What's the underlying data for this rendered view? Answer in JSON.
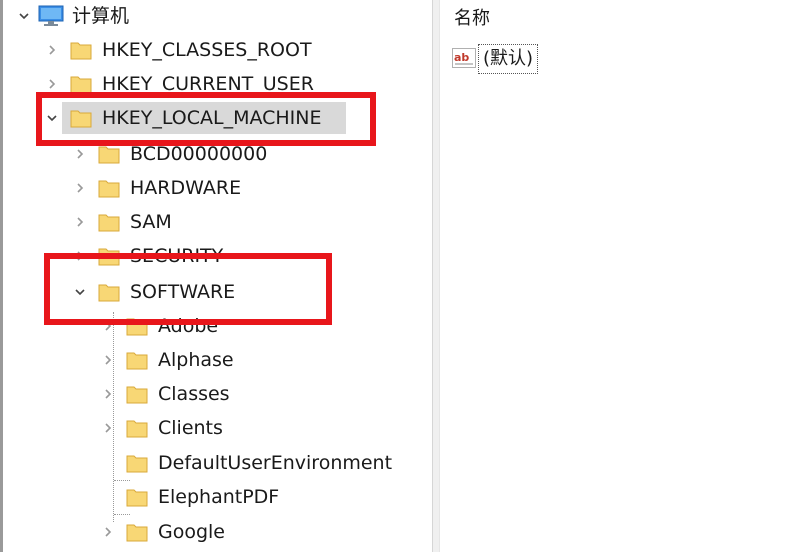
{
  "tree": {
    "root": {
      "label": "计算机"
    },
    "hives": [
      "HKEY_CLASSES_ROOT",
      "HKEY_CURRENT_USER",
      "HKEY_LOCAL_MACHINE"
    ],
    "hklm_children": [
      "BCD00000000",
      "HARDWARE",
      "SAM",
      "SECURITY",
      "SOFTWARE"
    ],
    "software_children": [
      "Adobe",
      "Alphase",
      "Classes",
      "Clients",
      "DefaultUserEnvironment",
      "ElephantPDF",
      "Google"
    ]
  },
  "values_pane": {
    "column_name": "名称",
    "default_value": "(默认)"
  },
  "colors": {
    "highlight_red": "#e8161b",
    "folder_yellow": "#f8d775",
    "selection_gray": "#d9d9d9"
  }
}
